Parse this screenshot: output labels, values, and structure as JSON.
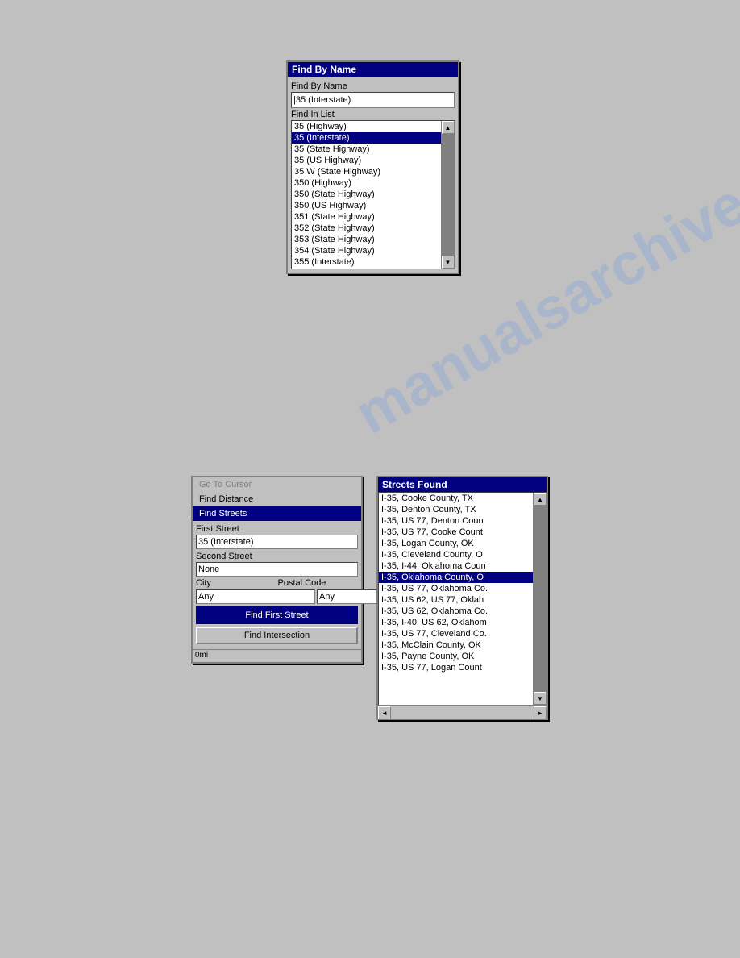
{
  "watermark": {
    "text": "manualsarchive.com"
  },
  "find_by_name_dialog": {
    "title": "Find By Name",
    "find_by_name_label": "Find By Name",
    "input_value": "35 (Interstate)",
    "find_in_list_label": "Find In List",
    "list_items": [
      "35 (Highway)",
      "35 (Interstate)",
      "35 (State Highway)",
      "35 (US Highway)",
      "35 W (State Highway)",
      "350 (Highway)",
      "350 (State Highway)",
      "350 (US Highway)",
      "351 (State Highway)",
      "352 (State Highway)",
      "353 (State Highway)",
      "354 (State Highway)",
      "355 (Interstate)"
    ],
    "selected_item": "35 (Interstate)"
  },
  "find_streets_dialog": {
    "menu_items": [
      {
        "label": "Go To Cursor",
        "state": "gray"
      },
      {
        "label": "Find Distance",
        "state": "normal"
      },
      {
        "label": "Find Streets",
        "state": "active"
      }
    ],
    "first_street_label": "First Street",
    "first_street_value": "35 (Interstate)",
    "second_street_label": "Second Street",
    "second_street_value": "None",
    "city_label": "City",
    "postal_code_label": "Postal Code",
    "city_value": "Any",
    "postal_value": "Any",
    "find_first_button": "Find First Street",
    "find_intersection_button": "Find Intersection",
    "status_text": "0mi"
  },
  "streets_found_dialog": {
    "title": "Streets Found",
    "items": [
      "I-35, Cooke County, TX",
      "I-35, Denton County, TX",
      "I-35, US 77, Denton Coun",
      "I-35, US 77, Cooke Count",
      "I-35, Logan County, OK",
      "I-35, Cleveland County, O",
      "I-35, I-44, Oklahoma Coun",
      "I-35, Oklahoma County, O",
      "I-35, US 77, Oklahoma Co.",
      "I-35, US 62, US 77, Oklah",
      "I-35, US 62, Oklahoma Co.",
      "I-35, I-40, US 62, Oklahom",
      "I-35, US 77, Cleveland Co.",
      "I-35, McClain County, OK",
      "I-35, Payne County, OK",
      "I-35, US 77, Logan Count"
    ],
    "selected_item": "I-35, Oklahoma County, O"
  }
}
